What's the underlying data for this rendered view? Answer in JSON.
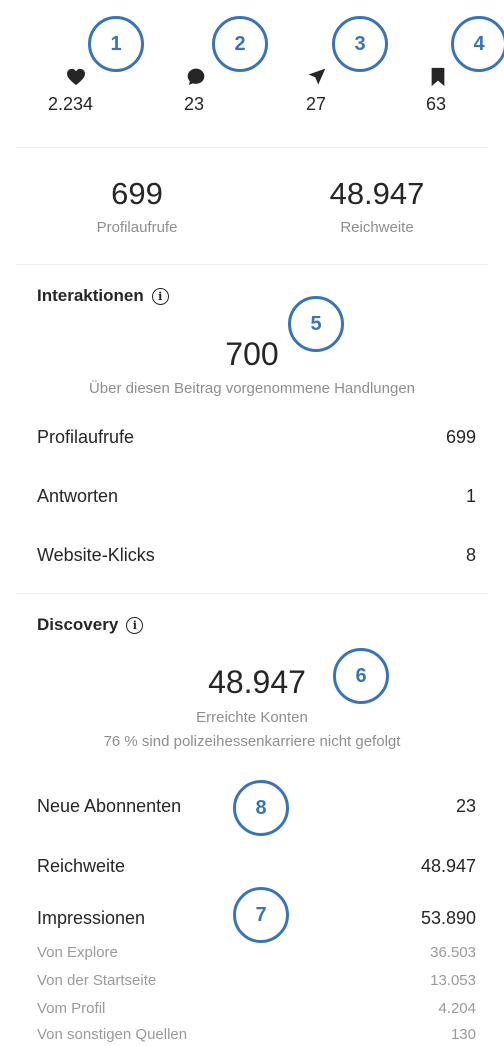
{
  "stats": {
    "likes": "2.234",
    "comments": "23",
    "shares": "27",
    "saves": "63"
  },
  "summary": {
    "profile_visits_value": "699",
    "profile_visits_label": "Profilaufrufe",
    "reach_value": "48.947",
    "reach_label": "Reichweite"
  },
  "interactions": {
    "title": "Interaktionen",
    "total": "700",
    "description": "Über diesen Beitrag vorgenommene Handlungen",
    "rows": [
      {
        "label": "Profilaufrufe",
        "value": "699"
      },
      {
        "label": "Antworten",
        "value": "1"
      },
      {
        "label": "Website-Klicks",
        "value": "8"
      }
    ]
  },
  "discovery": {
    "title": "Discovery",
    "total": "48.947",
    "description": "Erreichte Konten",
    "note": "76 % sind polizeihessenkarriere nicht gefolgt",
    "rows": [
      {
        "label": "Neue Abonnenten",
        "value": "23"
      },
      {
        "label": "Reichweite",
        "value": "48.947"
      },
      {
        "label": "Impressionen",
        "value": "53.890"
      }
    ],
    "sub_rows": [
      {
        "label": "Von Explore",
        "value": "36.503"
      },
      {
        "label": "Von der Startseite",
        "value": "13.053"
      },
      {
        "label": "Vom Profil",
        "value": "4.204"
      },
      {
        "label": "Von sonstigen Quellen",
        "value": "130"
      }
    ]
  },
  "annotations": [
    "1",
    "2",
    "3",
    "4",
    "5",
    "6",
    "7",
    "8"
  ],
  "colors": {
    "annotation": "#3a74b8",
    "text": "#262626",
    "muted": "#8e8e8e"
  },
  "icons": {
    "likes": "heart-icon",
    "comments": "comment-icon",
    "shares": "send-icon",
    "saves": "bookmark-icon",
    "info": "info-icon"
  }
}
